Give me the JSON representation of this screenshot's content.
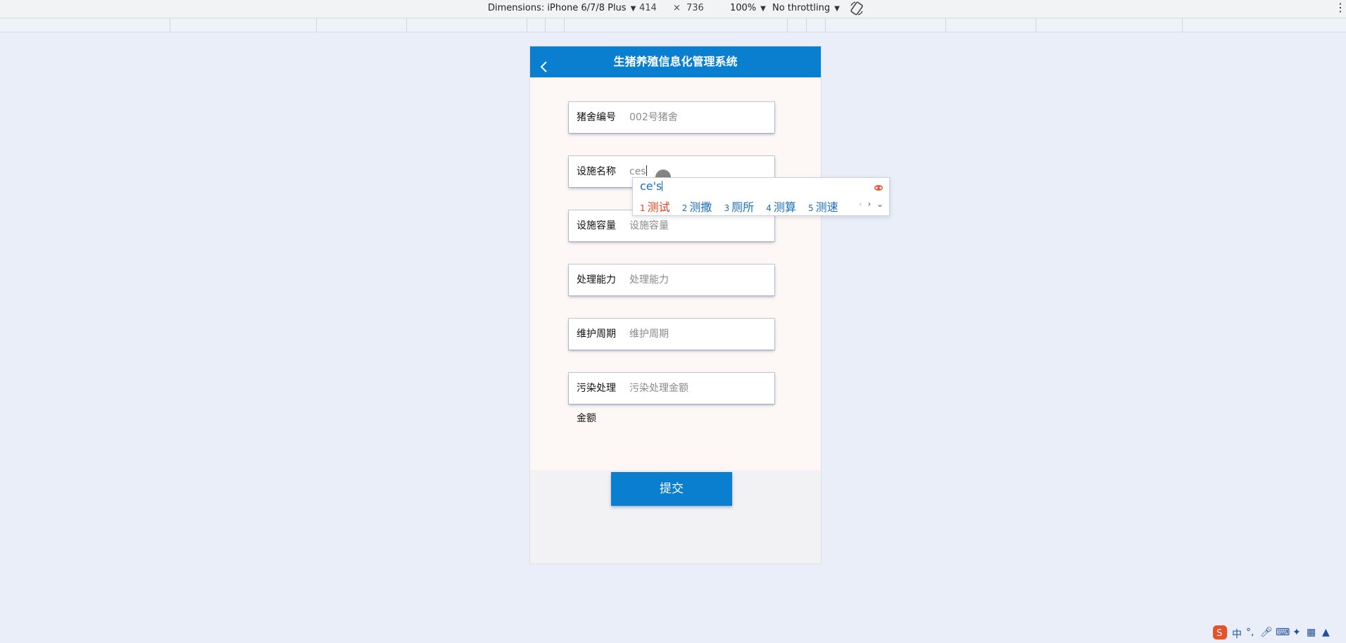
{
  "devtools": {
    "device_label": "Dimensions: iPhone 6/7/8 Plus",
    "width": "414",
    "times": "×",
    "height": "736",
    "zoom": "100%",
    "throttle": "No throttling",
    "rotate_icon": "rotate-icon",
    "more_icon": "more-vert-icon"
  },
  "app": {
    "title": "生猪养殖信息化管理系统",
    "back_icon": "chevron-left-icon"
  },
  "form": {
    "fields": [
      {
        "label": "猪舍编号",
        "value": "002号猪舍"
      },
      {
        "label": "设施名称",
        "value": "ces"
      },
      {
        "label": "设施容量",
        "placeholder": "设施容量"
      },
      {
        "label": "处理能力",
        "placeholder": "处理能力"
      },
      {
        "label": "维护周期",
        "placeholder": "维护周期"
      },
      {
        "label": "污染处理",
        "label_wrap": "金额",
        "placeholder": "污染处理金额"
      }
    ],
    "submit_label": "提交"
  },
  "ime": {
    "composition": "ce's",
    "candidates": [
      {
        "num": "1",
        "text": "测试"
      },
      {
        "num": "2",
        "text": "测撒"
      },
      {
        "num": "3",
        "text": "厕所"
      },
      {
        "num": "4",
        "text": "测算"
      },
      {
        "num": "5",
        "text": "测速"
      }
    ],
    "prev": "‹",
    "next": "›",
    "expand": "⌄"
  },
  "tray": {
    "lang": "中",
    "punct": "°,"
  },
  "colors": {
    "header": "#0a7fd0",
    "submit": "#0a7fd0",
    "ime_highlight": "#e2401c",
    "ime_text": "#1a6fc0"
  }
}
